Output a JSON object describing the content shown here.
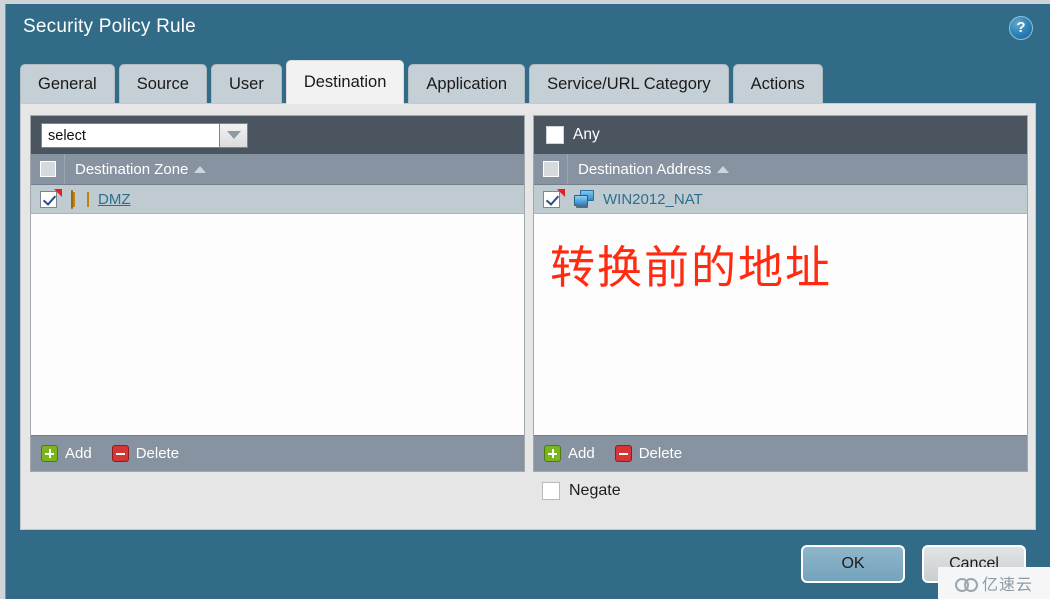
{
  "window": {
    "title": "Security Policy Rule",
    "help_icon": "help-circle-icon",
    "help_glyph": "?"
  },
  "tabs": [
    {
      "label": "General",
      "active": false
    },
    {
      "label": "Source",
      "active": false
    },
    {
      "label": "User",
      "active": false
    },
    {
      "label": "Destination",
      "active": true
    },
    {
      "label": "Application",
      "active": false
    },
    {
      "label": "Service/URL Category",
      "active": false
    },
    {
      "label": "Actions",
      "active": false
    }
  ],
  "destination": {
    "zone_panel": {
      "select_value": "select",
      "select_placeholder": "select",
      "dropdown_icon": "chevron-down-icon",
      "column_header": "Destination Zone",
      "sort_direction": "ascending",
      "rows": [
        {
          "label": "DMZ",
          "icon": "zone-icon",
          "checked": true,
          "flagged": true
        }
      ],
      "add_label": "Add",
      "delete_label": "Delete"
    },
    "address_panel": {
      "any_label": "Any",
      "any_checked": false,
      "column_header": "Destination Address",
      "sort_direction": "ascending",
      "rows": [
        {
          "label": "WIN2012_NAT",
          "icon": "host-icon",
          "checked": true,
          "flagged": true
        }
      ],
      "annotation": "转换前的地址",
      "annotation_color": "#ff2a10",
      "add_label": "Add",
      "delete_label": "Delete"
    },
    "negate": {
      "label": "Negate",
      "checked": false
    }
  },
  "footer": {
    "ok_label": "OK",
    "cancel_label": "Cancel"
  },
  "watermark": {
    "text": "亿速云",
    "logo_icon": "cloud-logo-icon"
  },
  "colors": {
    "title_bar": "#316b88",
    "tab_active": "#f2f2f2",
    "tab_inactive": "#c4d0d5",
    "panel_dark": "#4a5560",
    "panel_header": "#8793a0",
    "row_selected": "#bfcad1",
    "link": "#2e6f8e",
    "annotation": "#ff2a10"
  }
}
